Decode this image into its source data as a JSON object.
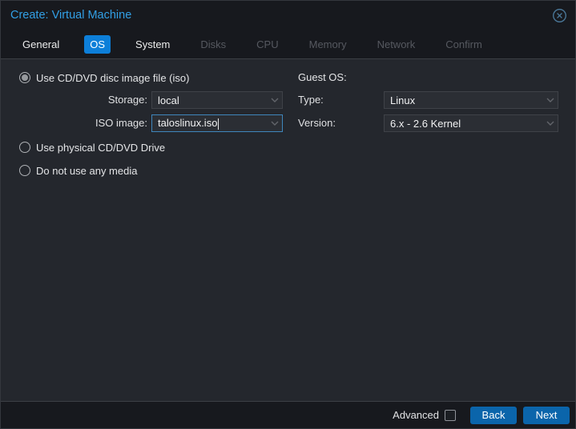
{
  "window": {
    "title": "Create: Virtual Machine"
  },
  "tabs": [
    {
      "label": "General",
      "state": "enabled"
    },
    {
      "label": "OS",
      "state": "selected"
    },
    {
      "label": "System",
      "state": "enabled"
    },
    {
      "label": "Disks",
      "state": "disabled"
    },
    {
      "label": "CPU",
      "state": "disabled"
    },
    {
      "label": "Memory",
      "state": "disabled"
    },
    {
      "label": "Network",
      "state": "disabled"
    },
    {
      "label": "Confirm",
      "state": "disabled"
    }
  ],
  "media": {
    "radios": [
      {
        "label": "Use CD/DVD disc image file (iso)",
        "selected": true
      },
      {
        "label": "Use physical CD/DVD Drive",
        "selected": false
      },
      {
        "label": "Do not use any media",
        "selected": false
      }
    ],
    "storage": {
      "label": "Storage:",
      "value": "local"
    },
    "iso_image": {
      "label": "ISO image:",
      "value": "taloslinux.iso",
      "focused": true
    }
  },
  "guest_os": {
    "heading": "Guest OS:",
    "type": {
      "label": "Type:",
      "value": "Linux"
    },
    "version": {
      "label": "Version:",
      "value": "6.x - 2.6 Kernel"
    }
  },
  "footer": {
    "advanced_label": "Advanced",
    "advanced_checked": false,
    "back_label": "Back",
    "next_label": "Next"
  },
  "colors": {
    "title_blue": "#32a0e6",
    "selected_tab_blue": "#0d7fd9",
    "button_blue": "#0b65ab",
    "focused_field_border": "#3f86bc",
    "panel_background": "#24272d",
    "window_background": "#17191e"
  }
}
